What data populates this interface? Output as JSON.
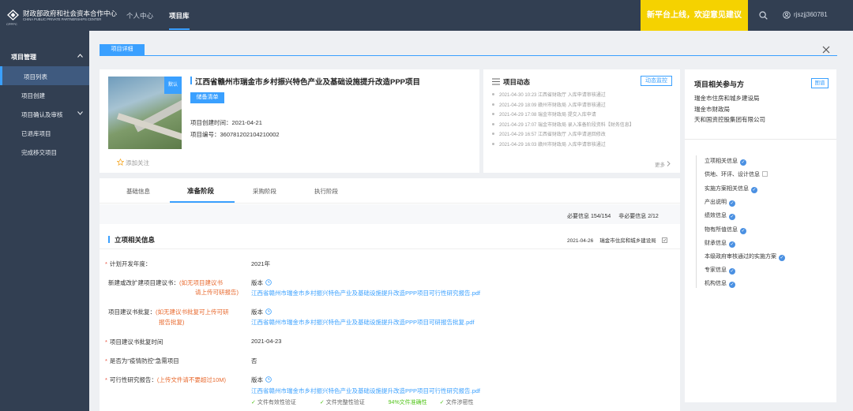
{
  "header": {
    "logo_cn": "财政部政府和社会资本合作中心",
    "logo_en": "CHINA PUBLIC PRIVATE PARTNERSHIPS CENTER",
    "logo_abbr": "CPPPC",
    "nav": [
      "个人中心",
      "项目库"
    ],
    "banner": "新平台上线，欢迎意见建议",
    "username": "rjszjj360781"
  },
  "sidebar": {
    "group": "项目管理",
    "items": [
      {
        "label": "项目列表"
      },
      {
        "label": "项目创建"
      },
      {
        "label": "项目确认及审核"
      },
      {
        "label": "已退库项目"
      },
      {
        "label": "完成移交项目"
      }
    ]
  },
  "page_tag": "项目详细",
  "project": {
    "image_badge": "默认",
    "title": "江西省赣州市瑞金市乡村振兴特色产业及基础设施提升改造PPP项目",
    "status": "储备清单",
    "created_label": "项目创建时间：",
    "created": "2021-04-21",
    "code_label": "项目编号：",
    "code": "360781202104210002",
    "follow": "添加关注"
  },
  "dynamics": {
    "title": "项目动态",
    "monitor": "动态监控",
    "rows": [
      "2021-04-30 10:23   江西省财政厅   入库申请审核通过",
      "2021-04-29 18:09   赣州市财政局   入库申请审核通过",
      "2021-04-29 17:08   瑞金市财政局   提交入库申请",
      "2021-04-29 17:07   瑞金市财政局   录入准备阶段资料【财务信息】",
      "2021-04-29 16:57   江西省财政厅   入库申请退回修改",
      "2021-04-29 16:03   赣州市财政局   入库申请审核通过"
    ],
    "more": "更多"
  },
  "participants": {
    "title": "项目相关参与方",
    "btn": "图谱",
    "orgs": [
      "瑞金市住房和城乡建设局",
      "瑞金市财政局",
      "天和国资控股集团有限公司"
    ],
    "nav": [
      {
        "label": "立项相关信息",
        "mark": "check"
      },
      {
        "label": "供地、环评、设计信息",
        "mark": "ext"
      },
      {
        "label": "实施方案相关信息",
        "mark": "check"
      },
      {
        "label": "产出说明",
        "mark": "check"
      },
      {
        "label": "绩效信息",
        "mark": "check"
      },
      {
        "label": "物有所值信息",
        "mark": "check"
      },
      {
        "label": "财承信息",
        "mark": "check"
      },
      {
        "label": "本级政府审核通过的实施方案",
        "mark": "check"
      },
      {
        "label": "专家信息",
        "mark": "check"
      },
      {
        "label": "机构信息",
        "mark": "check"
      }
    ]
  },
  "tabs": [
    "基础信息",
    "准备阶段",
    "采购阶段",
    "执行阶段"
  ],
  "counts": {
    "required": "必要信息 154/154",
    "optional": "非必要信息 2/12"
  },
  "section": {
    "title": "立项相关信息",
    "date": "2021-04-26",
    "dept": "瑞金市住房和城乡建设局"
  },
  "fields": {
    "plan_year_label": "计划开发年度：",
    "plan_year": "2021年",
    "proposal_label": "新建或改扩建项目建议书：",
    "proposal_warn1": "(如无项目建议书",
    "proposal_warn2": "请上传可研报告)",
    "version": "版本",
    "proposal_file": "江西省赣州市瑞金市乡村振兴特色产业及基础设施提升改造PPP项目可行性研究报告.pdf",
    "approval_label": "项目建议书批复：",
    "approval_warn1": "(如无建议书批复可上传可研",
    "approval_warn2": "报告批复)",
    "approval_file": "江西省赣州市瑞金市乡村振兴特色产业及基础设施提升改造PPP项目可研报告批复.pdf",
    "approval_time_label": "项目建议书批复时间",
    "approval_time": "2021-04-23",
    "epidemic_label": "是否为\"疫情防控\"急需项目",
    "epidemic": "否",
    "feasibility_label": "可行性研究报告：",
    "feasibility_warn": "(上传文件请不要超过10M)",
    "feasibility_file": "江西省赣州市瑞金市乡村振兴特色产业及基础设施提升改造PPP项目可行性研究报告.pdf",
    "check1": "文件有效性验证",
    "check2": "文件完整性验证",
    "check3": "94%文件准确性",
    "check4": "文件涉密性"
  }
}
